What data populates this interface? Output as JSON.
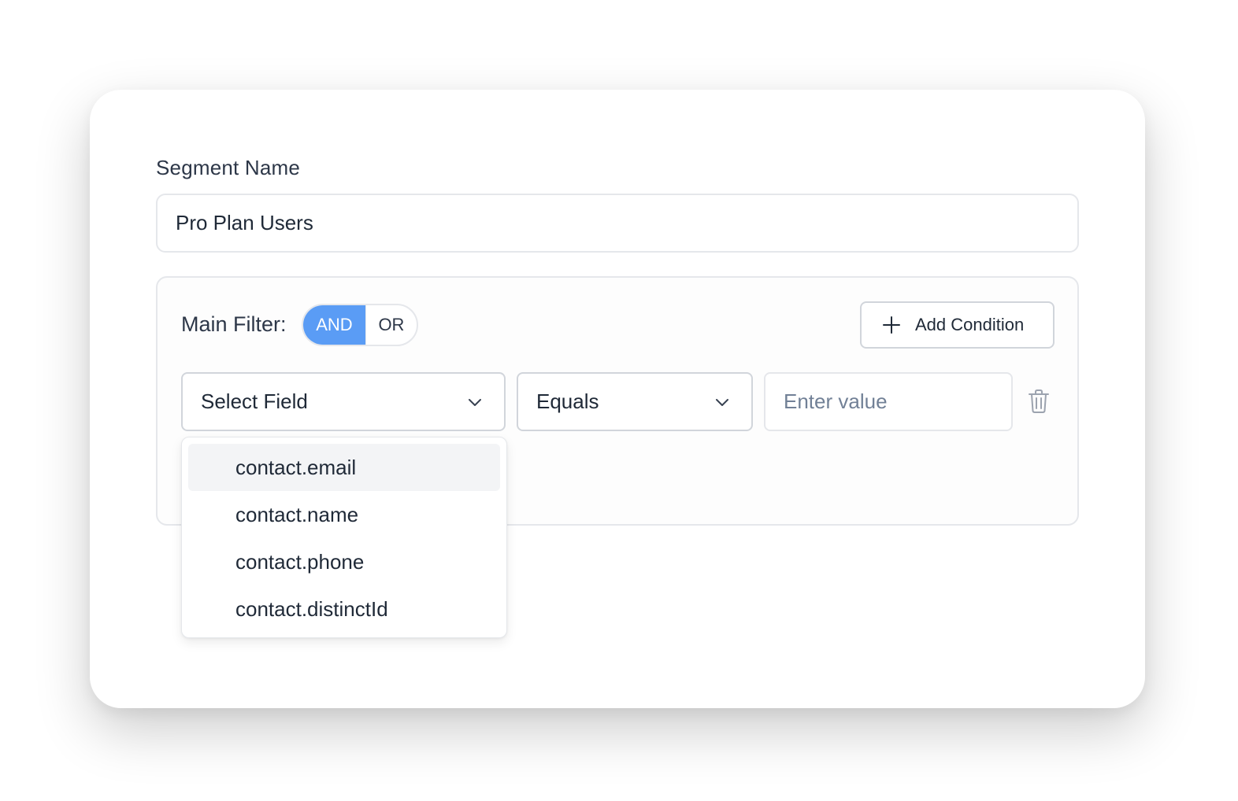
{
  "form": {
    "segment_name_label": "Segment Name",
    "segment_name_value": "Pro Plan Users"
  },
  "filter": {
    "main_filter_label": "Main Filter:",
    "toggle": {
      "and_label": "AND",
      "or_label": "OR",
      "selected": "AND",
      "active_color": "#5a9cf5"
    },
    "add_condition_label": "Add Condition",
    "condition": {
      "field_select_value": "Select Field",
      "operator_select_value": "Equals",
      "value_placeholder": "Enter value"
    }
  },
  "field_dropdown": {
    "items": [
      "contact.email",
      "contact.name",
      "contact.phone",
      "contact.distinctId"
    ],
    "highlighted_item": "contact.email"
  },
  "icons": {
    "add": "plus-icon",
    "select": "chevron-down-icon",
    "remove": "trash-icon"
  }
}
